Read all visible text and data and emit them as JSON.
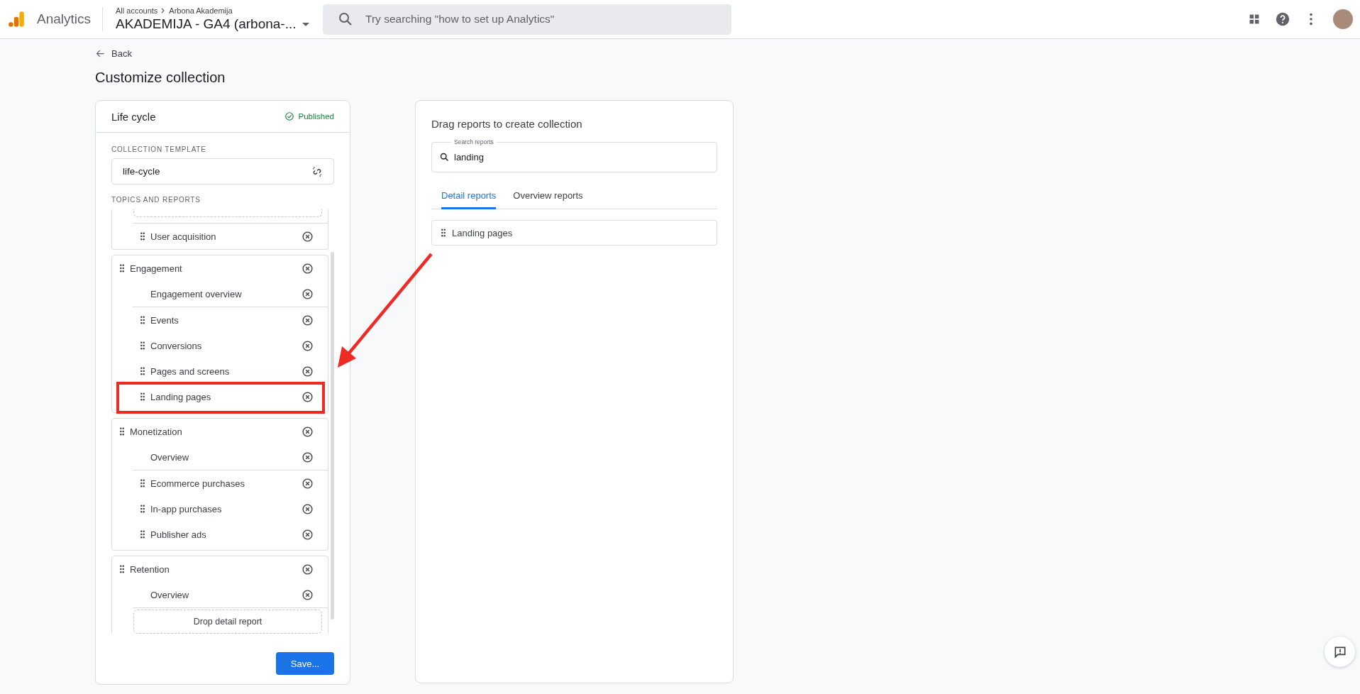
{
  "header": {
    "product": "Analytics",
    "breadcrumb": [
      "All accounts",
      "Arbona Akademija"
    ],
    "property": "AKADEMIJA - GA4 (arbona-...",
    "search": {
      "placeholder": "Try searching \"how to set up Analytics\""
    }
  },
  "page": {
    "back": "Back",
    "title": "Customize collection"
  },
  "collection": {
    "name": "Life cycle",
    "status": "Published",
    "template_label": "COLLECTION TEMPLATE",
    "template": "life-cycle",
    "topics_label": "TOPICS AND REPORTS",
    "groups": [
      {
        "kind": "clipped",
        "items": [
          {
            "kind": "detail",
            "name": "User acquisition",
            "highlighted": false
          }
        ]
      },
      {
        "kind": "topic",
        "title": "Engagement",
        "items": [
          {
            "kind": "overview",
            "name": "Engagement overview",
            "highlighted": false
          },
          {
            "kind": "detail",
            "name": "Events",
            "highlighted": false
          },
          {
            "kind": "detail",
            "name": "Conversions",
            "highlighted": false
          },
          {
            "kind": "detail",
            "name": "Pages and screens",
            "highlighted": false
          },
          {
            "kind": "detail",
            "name": "Landing pages",
            "highlighted": true
          }
        ]
      },
      {
        "kind": "topic",
        "title": "Monetization",
        "items": [
          {
            "kind": "overview",
            "name": "Overview",
            "highlighted": false
          },
          {
            "kind": "detail",
            "name": "Ecommerce purchases",
            "highlighted": false
          },
          {
            "kind": "detail",
            "name": "In-app purchases",
            "highlighted": false
          },
          {
            "kind": "detail",
            "name": "Publisher ads",
            "highlighted": false
          }
        ]
      },
      {
        "kind": "topic",
        "title": "Retention",
        "items": [
          {
            "kind": "overview",
            "name": "Overview",
            "highlighted": false
          }
        ],
        "drop_slot": "Drop detail report"
      }
    ],
    "save": "Save..."
  },
  "library": {
    "title": "Drag reports to create collection",
    "search": {
      "label": "Search reports",
      "value": "landing"
    },
    "tabs": [
      {
        "label": "Detail reports",
        "selected": true
      },
      {
        "label": "Overview reports",
        "selected": false
      }
    ],
    "results": [
      "Landing pages"
    ]
  }
}
